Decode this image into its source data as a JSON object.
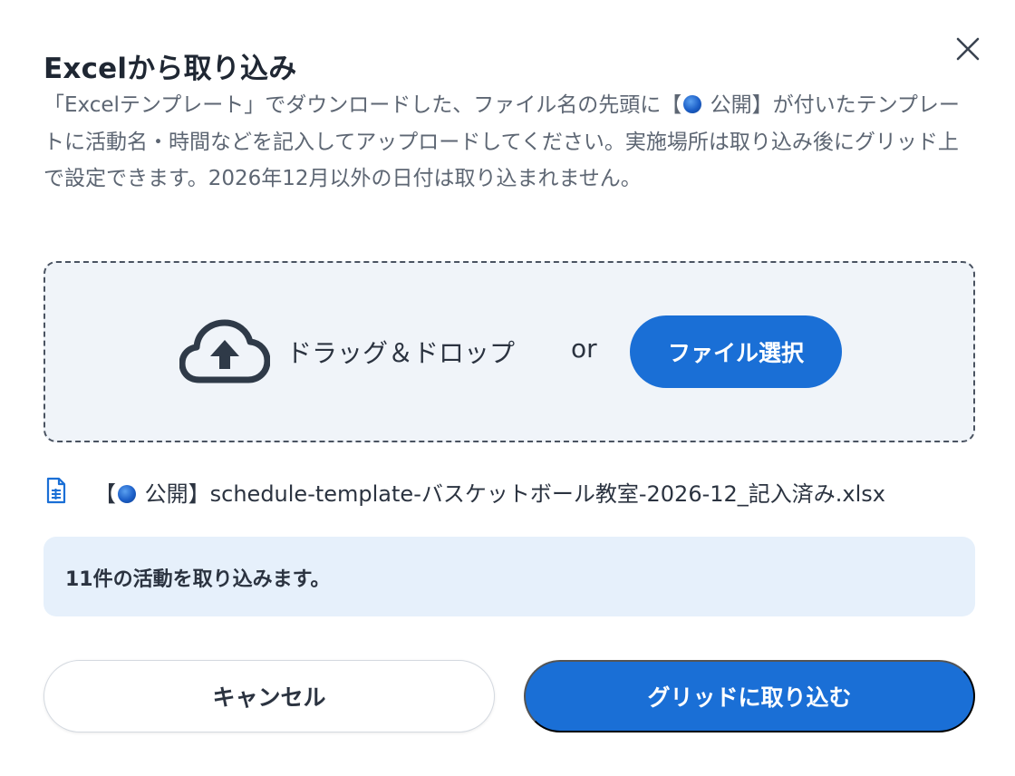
{
  "dialog": {
    "title": "Excelから取り込み",
    "close_icon": "close-icon",
    "description_before_badge": "「Excelテンプレート」でダウンロードした、ファイル名の先頭に【",
    "badge_label": "公開",
    "description_after_badge": "】が付いたテンプレートに活動名・時間などを記入してアップロードしてください。実施場所は取り込み後にグリッド上で設定できます。2026年12月以外の日付は取り込まれません。"
  },
  "dropzone": {
    "icon": "cloud-upload-icon",
    "drag_drop_label": "ドラッグ＆ドロップ",
    "or_label": "or",
    "file_select_label": "ファイル選択"
  },
  "selected_file": {
    "icon": "spreadsheet-file-icon",
    "prefix_open": "【",
    "badge_label": "公開",
    "name": "】schedule-template-バスケットボール教室-2026-12_記入済み.xlsx"
  },
  "info": {
    "message": "11件の活動を取り込みます。"
  },
  "actions": {
    "cancel_label": "キャンセル",
    "import_label": "グリッドに取り込む"
  },
  "colors": {
    "primary": "#1a6fd6",
    "info_background": "#e6f0fb",
    "dropzone_background": "#f0f4f9",
    "badge_globe": "#1c5fc8"
  }
}
